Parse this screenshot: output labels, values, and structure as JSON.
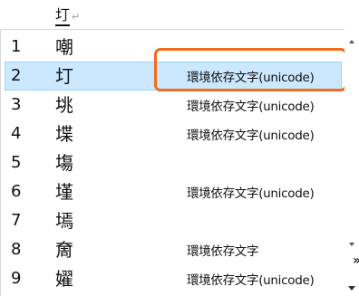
{
  "composition": {
    "text": "圢",
    "return_mark": "↵"
  },
  "candidates": [
    {
      "number": "1",
      "kanji": "嘲",
      "note": ""
    },
    {
      "number": "2",
      "kanji": "圢",
      "note": "環境依存文字(unicode)",
      "selected": true
    },
    {
      "number": "3",
      "kanji": "垗",
      "note": "環境依存文字(unicode)"
    },
    {
      "number": "4",
      "kanji": "堞",
      "note": "環境依存文字(unicode)"
    },
    {
      "number": "5",
      "kanji": "塲",
      "note": ""
    },
    {
      "number": "6",
      "kanji": "墐",
      "note": "環境依存文字(unicode)"
    },
    {
      "number": "7",
      "kanji": "墕",
      "note": ""
    },
    {
      "number": "8",
      "kanji": "奝",
      "note": "環境依存文字"
    },
    {
      "number": "9",
      "kanji": "嬥",
      "note": "環境依存文字(unicode)"
    }
  ],
  "highlight_color": "#f26b1a",
  "selection_color": "#cce8ff",
  "icons": {
    "scroll_up": "triangle-up",
    "scroll_down": "triangle-down",
    "expand": "»"
  }
}
